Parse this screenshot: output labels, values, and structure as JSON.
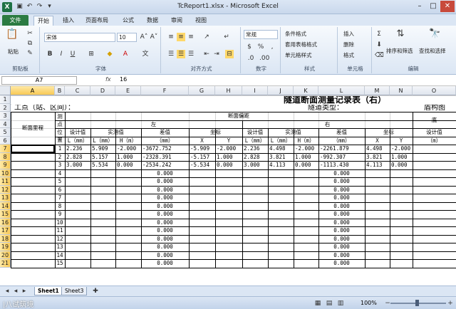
{
  "window": {
    "title": "TcReport1.xlsx - Microsoft Excel",
    "app_icon": "X"
  },
  "ribbon_tabs": [
    {
      "label": "文件"
    },
    {
      "label": "开始"
    },
    {
      "label": "插入"
    },
    {
      "label": "页面布局"
    },
    {
      "label": "公式"
    },
    {
      "label": "数据"
    },
    {
      "label": "审阅"
    },
    {
      "label": "视图"
    }
  ],
  "ribbon": {
    "clipboard": {
      "paste": "粘贴",
      "label": "剪贴板"
    },
    "font": {
      "name": "宋体",
      "size": "10",
      "label": "字体"
    },
    "alignment": {
      "label": "对齐方式"
    },
    "number": {
      "format": "常规",
      "label": "数字"
    },
    "styles": {
      "conditional": "条件格式",
      "table": "套用表格格式",
      "cell": "单元格样式",
      "label": "样式"
    },
    "cells": {
      "insert": "插入",
      "delete": "删除",
      "format": "格式",
      "label": "单元格"
    },
    "editing": {
      "sort": "排序和筛选",
      "find": "查找和选择",
      "label": "编辑"
    }
  },
  "formula_bar": {
    "name_box": "A7",
    "fx": "fx",
    "value": "16"
  },
  "columns": [
    "A",
    "B",
    "C",
    "D",
    "E",
    "F",
    "G",
    "H",
    "I",
    "J",
    "K",
    "L",
    "M",
    "N",
    "O"
  ],
  "rows": [
    "1",
    "2",
    "3",
    "4",
    "5",
    "6",
    "7",
    "8",
    "9",
    "10",
    "11",
    "12",
    "13",
    "14",
    "15",
    "16",
    "17",
    "18",
    "19",
    "20",
    "21"
  ],
  "sheet": {
    "title": "隧道断面测量记录表（右）",
    "location_label": "工点（站、区间）：",
    "tunnel_type_label": "隧道类型：",
    "section_type_label": "盾构图",
    "section_mileage": "断面里程",
    "point_no": "测点位置",
    "section_head": "断面偏距",
    "left": "左",
    "right": "右",
    "design_value": "设计值",
    "measured_value": "实测值",
    "diff": "差值",
    "coord": "坐标",
    "L_mm": "L（mm）",
    "H_mm": "H（m）",
    "mm": "（mm）",
    "X": "X",
    "Y": "Y",
    "m": "（m）",
    "floor": "底"
  },
  "data_rows": [
    {
      "n": "1",
      "l_design": "2.236",
      "l_L": "5.909",
      "l_H": "-2.000",
      "l_diff": "-3672.752",
      "l_x": "-5.909",
      "l_y": "-2.000",
      "r_design": "2.236",
      "r_L": "4.498",
      "r_H": "-2.000",
      "r_diff": "-2261.879",
      "r_x": "4.498",
      "r_y": "-2.000"
    },
    {
      "n": "2",
      "l_design": "2.828",
      "l_L": "5.157",
      "l_H": "1.000",
      "l_diff": "-2328.391",
      "l_x": "-5.157",
      "l_y": "1.000",
      "r_design": "2.828",
      "r_L": "3.821",
      "r_H": "1.000",
      "r_diff": "-992.307",
      "r_x": "3.821",
      "r_y": "1.000"
    },
    {
      "n": "3",
      "l_design": "3.000",
      "l_L": "5.534",
      "l_H": "0.000",
      "l_diff": "-2534.242",
      "l_x": "-5.534",
      "l_y": "0.000",
      "r_design": "3.000",
      "r_L": "4.113",
      "r_H": "0.000",
      "r_diff": "-1113.430",
      "r_x": "4.113",
      "r_y": "0.000"
    }
  ],
  "empty_rows": [
    {
      "n": "4",
      "l_diff": "0.000",
      "r_diff": "0.000"
    },
    {
      "n": "5",
      "l_diff": "0.000",
      "r_diff": "0.000"
    },
    {
      "n": "6",
      "l_diff": "0.000",
      "r_diff": "0.000"
    },
    {
      "n": "7",
      "l_diff": "0.000",
      "r_diff": "0.000"
    },
    {
      "n": "8",
      "l_diff": "0.000",
      "r_diff": "0.000"
    },
    {
      "n": "9",
      "l_diff": "0.000",
      "r_diff": "0.000"
    },
    {
      "n": "10",
      "l_diff": "0.000",
      "r_diff": "0.000"
    },
    {
      "n": "11",
      "l_diff": "0.000",
      "r_diff": "0.000"
    },
    {
      "n": "12",
      "l_diff": "0.000",
      "r_diff": "0.000"
    },
    {
      "n": "13",
      "l_diff": "0.000",
      "r_diff": "0.000"
    },
    {
      "n": "14",
      "l_diff": "0.000",
      "r_diff": "0.000"
    },
    {
      "n": "15",
      "l_diff": "0.000",
      "r_diff": "0.000"
    }
  ],
  "sheet_tabs": [
    "Sheet1",
    "Sheet3"
  ],
  "status": {
    "zoom": "100%",
    "watermark": "|八试筑境"
  },
  "colors": {
    "accent": "#2b7b42",
    "selection": "#f8c955"
  }
}
